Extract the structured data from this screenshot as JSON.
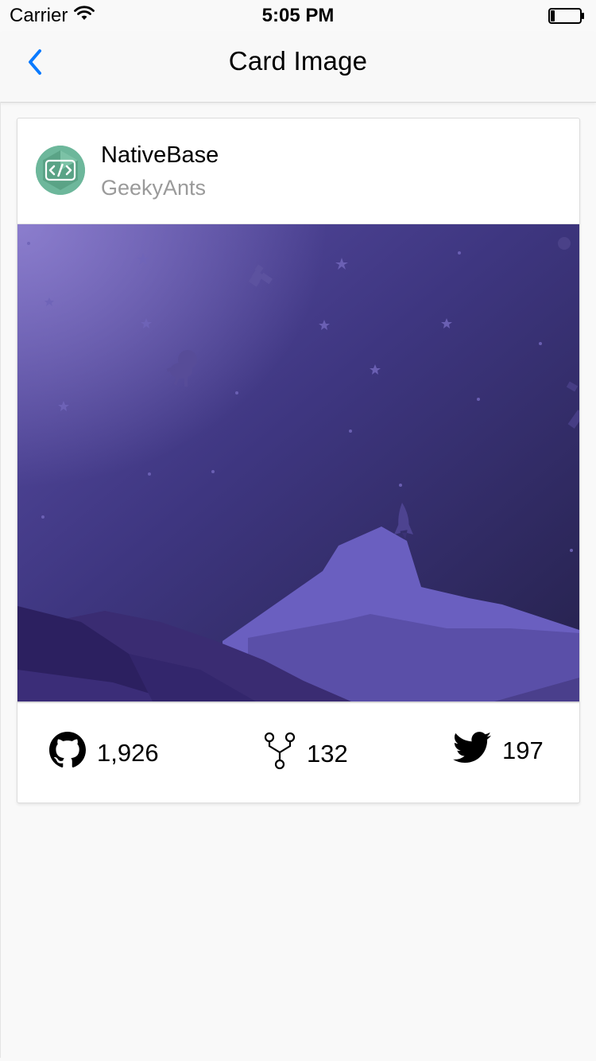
{
  "status_bar": {
    "carrier": "Carrier",
    "time": "5:05 PM",
    "battery_level": 0.15
  },
  "nav": {
    "title": "Card Image",
    "back_icon": "chevron-left-icon",
    "accent_color": "#0a7aff"
  },
  "card": {
    "title": "NativeBase",
    "subtitle": "GeekyAnts",
    "avatar_icon": "code-brackets-icon",
    "avatar_color": "#6db79b",
    "image_description_colors": {
      "sky_top": "#4a3f8c",
      "sky_bottom": "#2b2652",
      "mountain": "#6a5fc0"
    },
    "stats": {
      "github": {
        "icon": "github-icon",
        "value": "1,926"
      },
      "forks": {
        "icon": "fork-icon",
        "value": "132"
      },
      "twitter": {
        "icon": "twitter-icon",
        "value": "197"
      }
    }
  }
}
